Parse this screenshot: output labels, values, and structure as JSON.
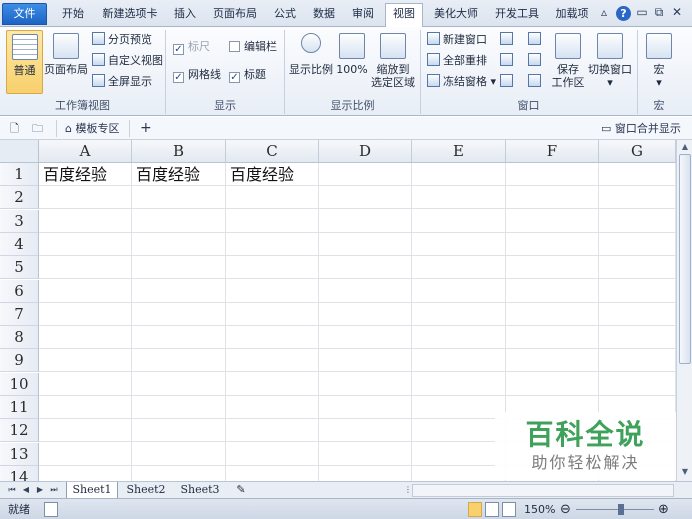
{
  "tabs": {
    "file": "文件",
    "items": [
      "开始",
      "新建选项卡",
      "插入",
      "页面布局",
      "公式",
      "数据",
      "审阅",
      "视图",
      "美化大师",
      "开发工具",
      "加载项"
    ],
    "active": "视图"
  },
  "ribbon": {
    "workbook_views": {
      "label": "工作簿视图",
      "normal": "普通",
      "page_layout": "页面布局",
      "page_break_preview": "分页预览",
      "custom_views": "自定义视图",
      "full_screen": "全屏显示"
    },
    "show": {
      "label": "显示",
      "ruler": "标尺",
      "formula_bar": "编辑栏",
      "gridlines": "网格线",
      "headings": "标题"
    },
    "zoom": {
      "label": "显示比例",
      "zoom": "显示比例",
      "hundred": "100%",
      "zoom_to_selection_1": "缩放到",
      "zoom_to_selection_2": "选定区域"
    },
    "window": {
      "label": "窗口",
      "new_window": "新建窗口",
      "arrange_all": "全部重排",
      "freeze_panes": "冻结窗格",
      "save_workspace_1": "保存",
      "save_workspace_2": "工作区",
      "switch_windows": "切换窗口"
    },
    "macros": {
      "label": "宏",
      "macros": "宏"
    }
  },
  "docbar": {
    "template_zone": "模板专区",
    "add": "+",
    "merge_windows": "窗口合并显示"
  },
  "sheet": {
    "columns": [
      "A",
      "B",
      "C",
      "D",
      "E",
      "F",
      "G"
    ],
    "rows": [
      "1",
      "2",
      "3",
      "4",
      "5",
      "6",
      "7",
      "8",
      "9",
      "10",
      "11",
      "12",
      "13",
      "14"
    ],
    "cells": {
      "A1": "百度经验",
      "B1": "百度经验",
      "C1": "百度经验"
    }
  },
  "sheet_tabs": [
    "Sheet1",
    "Sheet2",
    "Sheet3"
  ],
  "status": {
    "ready": "就绪",
    "zoom": "150%"
  },
  "watermark": {
    "title": "百科全说",
    "subtitle": "助你轻松解决"
  },
  "colors": {
    "file_tab": "#1d63c4",
    "pressed": "#f8d06c",
    "watermark_green": "#3fa15a"
  }
}
